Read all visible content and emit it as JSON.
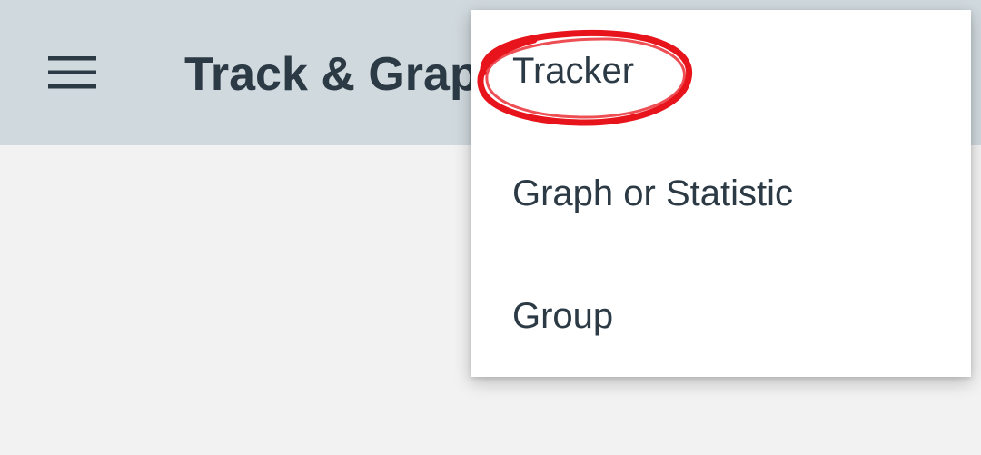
{
  "toolbar": {
    "title": "Track & Grap",
    "menu_icon": "hamburger-menu-icon",
    "background": "#d0d9de",
    "text_color": "#2c3a45"
  },
  "popup_menu": {
    "items": [
      {
        "label": "Tracker"
      },
      {
        "label": "Graph or Statistic"
      },
      {
        "label": "Group"
      }
    ]
  },
  "annotation": {
    "shape": "hand-drawn ellipse",
    "color": "#e8141b",
    "target": "Tracker"
  },
  "colors": {
    "content_background": "#f2f2f2",
    "menu_background": "#ffffff"
  }
}
